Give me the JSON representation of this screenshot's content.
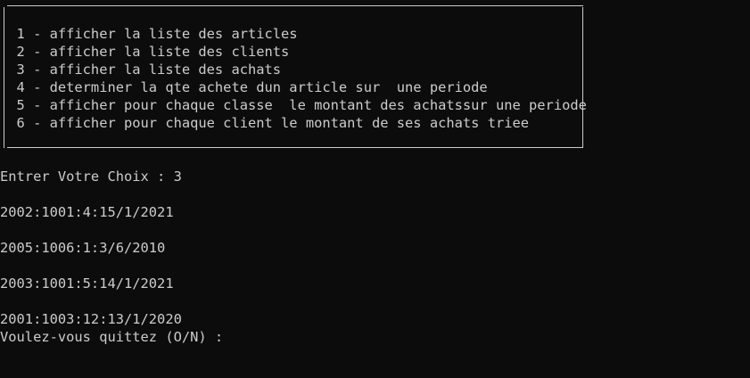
{
  "menu": {
    "items": [
      "  1 - afficher la liste des articles",
      "  2 - afficher la liste des clients",
      "  3 - afficher la liste des achats",
      "  4 - determiner la qte achete dun article sur  une periode",
      "  5 - afficher pour chaque classe  le montant des achatssur une periode",
      "  6 - afficher pour chaque client le montant de ses achats triee"
    ]
  },
  "prompt": {
    "choice": "Entrer Votre Choix : 3"
  },
  "results": [
    "2002:1001:4:15/1/2021",
    "2005:1006:1:3/6/2010",
    "2003:1001:5:14/1/2021",
    "2001:1003:12:13/1/2020"
  ],
  "quit_prompt": "Voulez-vous quittez (O/N) : "
}
